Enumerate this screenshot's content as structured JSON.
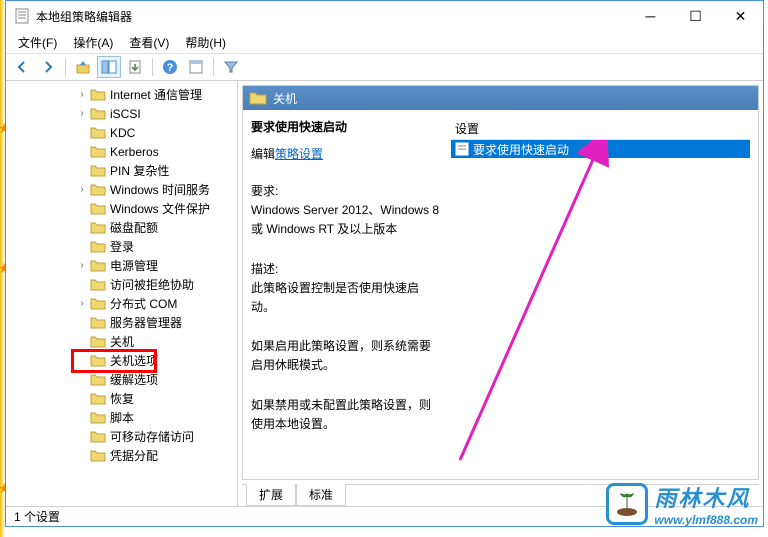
{
  "window": {
    "title": "本地组策略编辑器"
  },
  "menu": {
    "file": "文件(F)",
    "action": "操作(A)",
    "view": "查看(V)",
    "help": "帮助(H)"
  },
  "tree": {
    "items": [
      {
        "label": "Internet 通信管理",
        "expandable": true,
        "level": 1
      },
      {
        "label": "iSCSI",
        "expandable": true,
        "level": 1
      },
      {
        "label": "KDC",
        "expandable": false,
        "level": 1
      },
      {
        "label": "Kerberos",
        "expandable": false,
        "level": 1
      },
      {
        "label": "PIN 复杂性",
        "expandable": false,
        "level": 1
      },
      {
        "label": "Windows 时间服务",
        "expandable": true,
        "level": 1
      },
      {
        "label": "Windows 文件保护",
        "expandable": false,
        "level": 1
      },
      {
        "label": "磁盘配额",
        "expandable": false,
        "level": 1
      },
      {
        "label": "登录",
        "expandable": false,
        "level": 1
      },
      {
        "label": "电源管理",
        "expandable": true,
        "level": 1
      },
      {
        "label": "访问被拒绝协助",
        "expandable": false,
        "level": 1
      },
      {
        "label": "分布式 COM",
        "expandable": true,
        "level": 1
      },
      {
        "label": "服务器管理器",
        "expandable": false,
        "level": 1
      },
      {
        "label": "关机",
        "expandable": false,
        "level": 1,
        "selected": true
      },
      {
        "label": "关机选项",
        "expandable": false,
        "level": 1
      },
      {
        "label": "缓解选项",
        "expandable": false,
        "level": 1
      },
      {
        "label": "恢复",
        "expandable": false,
        "level": 1
      },
      {
        "label": "脚本",
        "expandable": false,
        "level": 1
      },
      {
        "label": "可移动存储访问",
        "expandable": false,
        "level": 1
      },
      {
        "label": "凭据分配",
        "expandable": false,
        "level": 1
      }
    ]
  },
  "detail": {
    "header": "关机",
    "title": "要求使用快速启动",
    "editPrefix": "编辑",
    "editLink": "策略设置",
    "reqLabel": "要求:",
    "reqText": "Windows Server 2012、Windows 8 或 Windows RT 及以上版本",
    "descLabel": "描述:",
    "descText": "此策略设置控制是否使用快速启动。",
    "para1": "如果启用此策略设置，则系统需要启用休眠模式。",
    "para2": "如果禁用或未配置此策略设置，则使用本地设置。",
    "colSetting": "设置",
    "settingItem": "要求使用快速启动"
  },
  "tabs": {
    "extended": "扩展",
    "standard": "标准"
  },
  "status": "1 个设置",
  "watermark": {
    "title": "雨林木风",
    "url": "www.ylmf888.com"
  }
}
